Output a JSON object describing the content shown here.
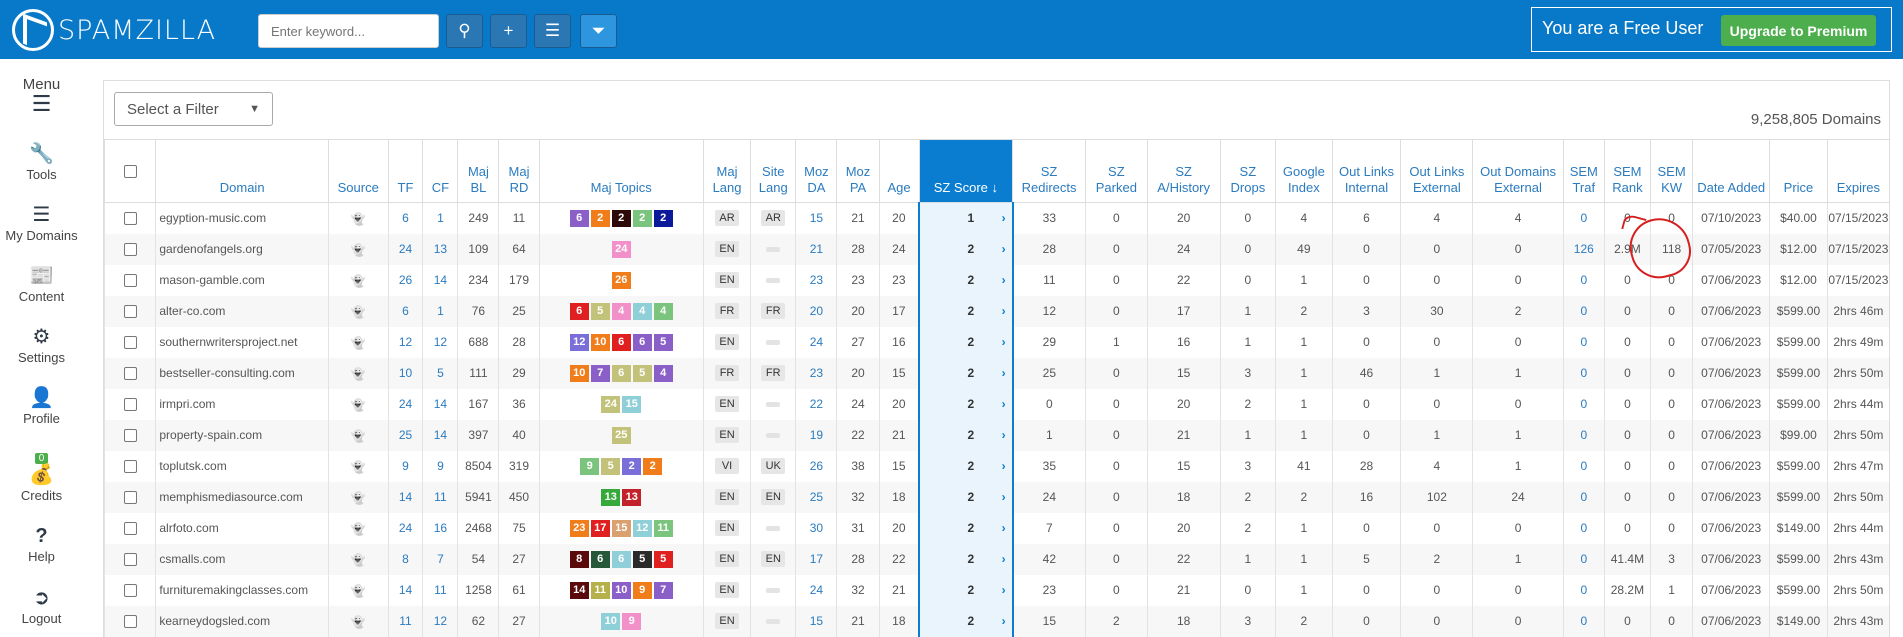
{
  "header": {
    "logo_text": "SPAMZILLA",
    "search_placeholder": "Enter keyword...",
    "user_status": "You are a Free User",
    "upgrade_label": "Upgrade to Premium",
    "accent": "#0879c9"
  },
  "sidebar": {
    "items": [
      {
        "label": "Menu",
        "icon": "hamburger-icon"
      },
      {
        "label": "Tools",
        "icon": "wrench-icon"
      },
      {
        "label": "My Domains",
        "icon": "list-icon"
      },
      {
        "label": "Content",
        "icon": "newspaper-icon"
      },
      {
        "label": "Settings",
        "icon": "gears-icon"
      },
      {
        "label": "Profile",
        "icon": "user-icon"
      },
      {
        "label": "Credits",
        "icon": "wallet-icon",
        "badge": "0"
      },
      {
        "label": "Help",
        "icon": "question-icon"
      },
      {
        "label": "Logout",
        "icon": "logout-icon"
      }
    ]
  },
  "filter": {
    "selected": "Select a Filter"
  },
  "domain_count": "9,258,805 Domains",
  "columns": [
    "Domain",
    "Source",
    "TF",
    "CF",
    "Maj BL",
    "Maj RD",
    "Maj Topics",
    "Maj Lang",
    "Site Lang",
    "Moz DA",
    "Moz PA",
    "Age",
    "SZ Score",
    "SZ Redirects",
    "SZ Parked",
    "SZ A/History",
    "SZ Drops",
    "Google Index",
    "Out Links Internal",
    "Out Links External",
    "Out Domains External",
    "SEM Traf",
    "SEM Rank",
    "SEM KW",
    "Date Added",
    "Price",
    "Expires"
  ],
  "topic_colors": {
    "o": "#f07d1a",
    "p": "#8a5fc8",
    "d": "#2c0a0a",
    "g": "#7bc47d",
    "n": "#0a1a9a",
    "pk": "#f291c9",
    "r": "#e02020",
    "k": "#c2c27a",
    "t": "#8fcfd8",
    "b": "#7a6fd8",
    "gr": "#37a83a",
    "dr": "#c2222a",
    "dg": "#27583a",
    "bl": "#2a2a2a",
    "tn": "#d9a070",
    "br": "#5a0a0a",
    "ol": "#b5b04a"
  },
  "rows": [
    {
      "domain": "egyption-music.com",
      "tf": "6",
      "cf": "1",
      "bl": "249",
      "rd": "11",
      "topics": [
        [
          "6",
          "p"
        ],
        [
          "2",
          "o"
        ],
        [
          "2",
          "d"
        ],
        [
          "2",
          "g"
        ],
        [
          "2",
          "n"
        ]
      ],
      "mlang": "AR",
      "slang": "AR",
      "da": "15",
      "pa": "21",
      "age": "20",
      "sz": "1",
      "redir": "33",
      "parked": "0",
      "hist": "20",
      "drops": "0",
      "gidx": "4",
      "oli": "6",
      "ole": "4",
      "ode": "4",
      "traf": "0",
      "rank": "0",
      "kw": "0",
      "date": "07/10/2023",
      "price": "$40.00",
      "expires": "07/15/2023"
    },
    {
      "domain": "gardenofangels.org",
      "tf": "24",
      "cf": "13",
      "bl": "109",
      "rd": "64",
      "topics": [
        [
          "24",
          "pk"
        ]
      ],
      "mlang": "EN",
      "slang": "",
      "da": "21",
      "pa": "28",
      "age": "24",
      "sz": "2",
      "redir": "28",
      "parked": "0",
      "hist": "24",
      "drops": "0",
      "gidx": "49",
      "oli": "0",
      "ole": "0",
      "ode": "0",
      "traf": "126",
      "rank": "2.9M",
      "kw": "118",
      "date": "07/05/2023",
      "price": "$12.00",
      "expires": "07/15/2023"
    },
    {
      "domain": "mason-gamble.com",
      "tf": "26",
      "cf": "14",
      "bl": "234",
      "rd": "179",
      "topics": [
        [
          "26",
          "o"
        ]
      ],
      "mlang": "EN",
      "slang": "",
      "da": "23",
      "pa": "23",
      "age": "23",
      "sz": "2",
      "redir": "11",
      "parked": "0",
      "hist": "22",
      "drops": "0",
      "gidx": "1",
      "oli": "0",
      "ole": "0",
      "ode": "0",
      "traf": "0",
      "rank": "0",
      "kw": "0",
      "date": "07/06/2023",
      "price": "$12.00",
      "expires": "07/15/2023"
    },
    {
      "domain": "alter-co.com",
      "tf": "6",
      "cf": "1",
      "bl": "76",
      "rd": "25",
      "topics": [
        [
          "6",
          "r"
        ],
        [
          "5",
          "k"
        ],
        [
          "4",
          "pk"
        ],
        [
          "4",
          "t"
        ],
        [
          "4",
          "g"
        ]
      ],
      "mlang": "FR",
      "slang": "FR",
      "da": "20",
      "pa": "20",
      "age": "17",
      "sz": "2",
      "redir": "12",
      "parked": "0",
      "hist": "17",
      "drops": "1",
      "gidx": "2",
      "oli": "3",
      "ole": "30",
      "ode": "2",
      "traf": "0",
      "rank": "0",
      "kw": "0",
      "date": "07/06/2023",
      "price": "$599.00",
      "expires": "2hrs 46m"
    },
    {
      "domain": "southernwritersproject.net",
      "tf": "12",
      "cf": "12",
      "bl": "688",
      "rd": "28",
      "topics": [
        [
          "12",
          "b"
        ],
        [
          "10",
          "o"
        ],
        [
          "6",
          "r"
        ],
        [
          "6",
          "p"
        ],
        [
          "5",
          "p"
        ]
      ],
      "mlang": "EN",
      "slang": "",
      "da": "24",
      "pa": "27",
      "age": "16",
      "sz": "2",
      "redir": "29",
      "parked": "1",
      "hist": "16",
      "drops": "1",
      "gidx": "1",
      "oli": "0",
      "ole": "0",
      "ode": "0",
      "traf": "0",
      "rank": "0",
      "kw": "0",
      "date": "07/06/2023",
      "price": "$599.00",
      "expires": "2hrs 49m"
    },
    {
      "domain": "bestseller-consulting.com",
      "tf": "10",
      "cf": "5",
      "bl": "111",
      "rd": "29",
      "topics": [
        [
          "10",
          "o"
        ],
        [
          "7",
          "p"
        ],
        [
          "6",
          "k"
        ],
        [
          "5",
          "k"
        ],
        [
          "4",
          "p"
        ]
      ],
      "mlang": "FR",
      "slang": "FR",
      "da": "23",
      "pa": "20",
      "age": "15",
      "sz": "2",
      "redir": "25",
      "parked": "0",
      "hist": "15",
      "drops": "3",
      "gidx": "1",
      "oli": "46",
      "ole": "1",
      "ode": "1",
      "traf": "0",
      "rank": "0",
      "kw": "0",
      "date": "07/06/2023",
      "price": "$599.00",
      "expires": "2hrs 50m"
    },
    {
      "domain": "irmpri.com",
      "tf": "24",
      "cf": "14",
      "bl": "167",
      "rd": "36",
      "topics": [
        [
          "24",
          "k"
        ],
        [
          "15",
          "t"
        ]
      ],
      "mlang": "EN",
      "slang": "",
      "da": "22",
      "pa": "24",
      "age": "20",
      "sz": "2",
      "redir": "0",
      "parked": "0",
      "hist": "20",
      "drops": "2",
      "gidx": "1",
      "oli": "0",
      "ole": "0",
      "ode": "0",
      "traf": "0",
      "rank": "0",
      "kw": "0",
      "date": "07/06/2023",
      "price": "$599.00",
      "expires": "2hrs 44m"
    },
    {
      "domain": "property-spain.com",
      "tf": "25",
      "cf": "14",
      "bl": "397",
      "rd": "40",
      "topics": [
        [
          "25",
          "k"
        ]
      ],
      "mlang": "EN",
      "slang": "",
      "da": "19",
      "pa": "22",
      "age": "21",
      "sz": "2",
      "redir": "1",
      "parked": "0",
      "hist": "21",
      "drops": "1",
      "gidx": "1",
      "oli": "0",
      "ole": "1",
      "ode": "1",
      "traf": "0",
      "rank": "0",
      "kw": "0",
      "date": "07/06/2023",
      "price": "$99.00",
      "expires": "2hrs 50m"
    },
    {
      "domain": "toplutsk.com",
      "tf": "9",
      "cf": "9",
      "bl": "8504",
      "rd": "319",
      "topics": [
        [
          "9",
          "g"
        ],
        [
          "5",
          "k"
        ],
        [
          "2",
          "b"
        ],
        [
          "2",
          "o"
        ]
      ],
      "mlang": "VI",
      "slang": "UK",
      "da": "26",
      "pa": "38",
      "age": "15",
      "sz": "2",
      "redir": "35",
      "parked": "0",
      "hist": "15",
      "drops": "3",
      "gidx": "41",
      "oli": "28",
      "ole": "4",
      "ode": "1",
      "traf": "0",
      "rank": "0",
      "kw": "0",
      "date": "07/06/2023",
      "price": "$599.00",
      "expires": "2hrs 47m"
    },
    {
      "domain": "memphismediasource.com",
      "tf": "14",
      "cf": "11",
      "bl": "5941",
      "rd": "450",
      "topics": [
        [
          "13",
          "gr"
        ],
        [
          "13",
          "dr"
        ]
      ],
      "mlang": "EN",
      "slang": "EN",
      "da": "25",
      "pa": "32",
      "age": "18",
      "sz": "2",
      "redir": "24",
      "parked": "0",
      "hist": "18",
      "drops": "2",
      "gidx": "2",
      "oli": "16",
      "ole": "102",
      "ode": "24",
      "traf": "0",
      "rank": "0",
      "kw": "0",
      "date": "07/06/2023",
      "price": "$599.00",
      "expires": "2hrs 50m"
    },
    {
      "domain": "alrfoto.com",
      "tf": "24",
      "cf": "16",
      "bl": "2468",
      "rd": "75",
      "topics": [
        [
          "23",
          "o"
        ],
        [
          "17",
          "r"
        ],
        [
          "15",
          "tn"
        ],
        [
          "12",
          "t"
        ],
        [
          "11",
          "g"
        ]
      ],
      "mlang": "EN",
      "slang": "",
      "da": "30",
      "pa": "31",
      "age": "20",
      "sz": "2",
      "redir": "7",
      "parked": "0",
      "hist": "20",
      "drops": "2",
      "gidx": "1",
      "oli": "0",
      "ole": "0",
      "ode": "0",
      "traf": "0",
      "rank": "0",
      "kw": "0",
      "date": "07/06/2023",
      "price": "$149.00",
      "expires": "2hrs 44m"
    },
    {
      "domain": "csmalls.com",
      "tf": "8",
      "cf": "7",
      "bl": "54",
      "rd": "27",
      "topics": [
        [
          "8",
          "br"
        ],
        [
          "6",
          "dg"
        ],
        [
          "6",
          "t"
        ],
        [
          "5",
          "bl"
        ],
        [
          "5",
          "r"
        ]
      ],
      "mlang": "EN",
      "slang": "EN",
      "da": "17",
      "pa": "28",
      "age": "22",
      "sz": "2",
      "redir": "42",
      "parked": "0",
      "hist": "22",
      "drops": "1",
      "gidx": "1",
      "oli": "5",
      "ole": "2",
      "ode": "1",
      "traf": "0",
      "rank": "41.4M",
      "kw": "3",
      "date": "07/06/2023",
      "price": "$599.00",
      "expires": "2hrs 43m"
    },
    {
      "domain": "furnituremakingclasses.com",
      "tf": "14",
      "cf": "11",
      "bl": "1258",
      "rd": "61",
      "topics": [
        [
          "14",
          "br"
        ],
        [
          "11",
          "ol"
        ],
        [
          "10",
          "p"
        ],
        [
          "9",
          "o"
        ],
        [
          "7",
          "p"
        ]
      ],
      "mlang": "EN",
      "slang": "",
      "da": "24",
      "pa": "32",
      "age": "21",
      "sz": "2",
      "redir": "23",
      "parked": "0",
      "hist": "21",
      "drops": "0",
      "gidx": "1",
      "oli": "0",
      "ole": "0",
      "ode": "0",
      "traf": "0",
      "rank": "28.2M",
      "kw": "1",
      "date": "07/06/2023",
      "price": "$599.00",
      "expires": "2hrs 50m"
    },
    {
      "domain": "kearneydogsled.com",
      "tf": "11",
      "cf": "12",
      "bl": "62",
      "rd": "27",
      "topics": [
        [
          "10",
          "t"
        ],
        [
          "9",
          "pk"
        ]
      ],
      "mlang": "EN",
      "slang": "",
      "da": "15",
      "pa": "21",
      "age": "18",
      "sz": "2",
      "redir": "15",
      "parked": "2",
      "hist": "18",
      "drops": "3",
      "gidx": "2",
      "oli": "0",
      "ole": "0",
      "ode": "0",
      "traf": "0",
      "rank": "0",
      "kw": "0",
      "date": "07/06/2023",
      "price": "$149.00",
      "expires": "2hrs 43m"
    }
  ]
}
